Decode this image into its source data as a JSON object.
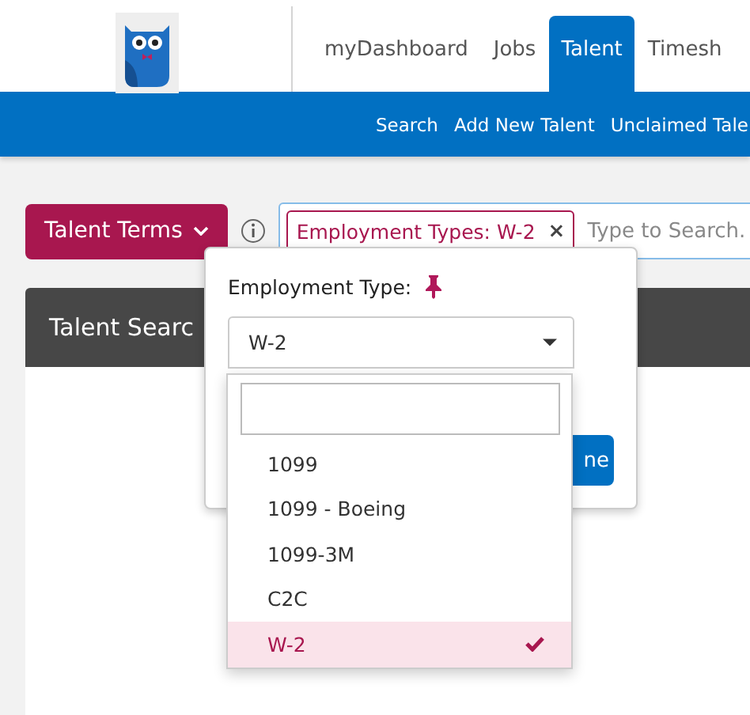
{
  "nav": {
    "tabs": [
      {
        "label": "myDashboard",
        "selected": false
      },
      {
        "label": "Jobs",
        "selected": false
      },
      {
        "label": "Talent",
        "selected": true
      },
      {
        "label": "Timesh",
        "selected": false
      }
    ]
  },
  "subnav": {
    "links": [
      "Search",
      "Add New Talent",
      "Unclaimed Tale"
    ]
  },
  "toolbar": {
    "terms_button": "Talent Terms",
    "search": {
      "tags": [
        {
          "label": "Employment Types: W-2",
          "remove": "×"
        }
      ],
      "placeholder": "Type to Search."
    }
  },
  "panel": {
    "title": "Talent Searc"
  },
  "popup": {
    "label": "Employment Type:",
    "select": {
      "value": "W-2",
      "expanded": true
    },
    "button": "ne",
    "options": [
      {
        "label": "1099",
        "selected": false
      },
      {
        "label": "1099 - Boeing",
        "selected": false
      },
      {
        "label": "1099-3M",
        "selected": false
      },
      {
        "label": "C2C",
        "selected": false
      },
      {
        "label": "W-2",
        "selected": true
      }
    ]
  }
}
